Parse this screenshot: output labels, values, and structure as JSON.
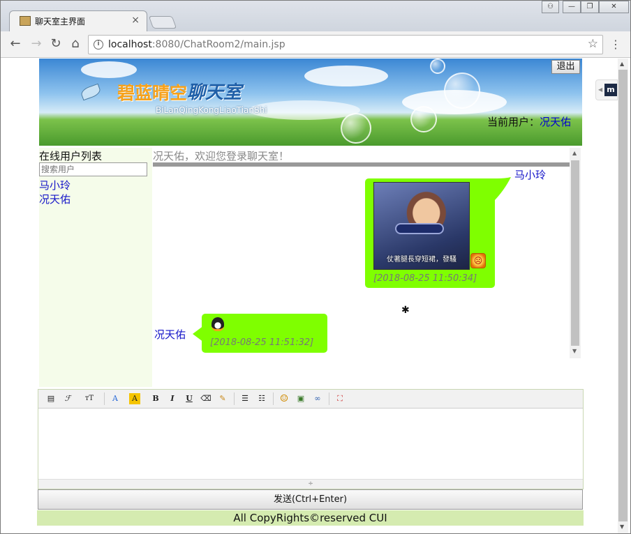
{
  "browser": {
    "tab_title": "聊天室主界面",
    "tab_close": "×",
    "url_host": "localhost",
    "url_rest": ":8080/ChatRoom2/main.jsp",
    "back_glyph": "←",
    "forward_glyph": "→",
    "reload_glyph": "↻",
    "home_glyph": "⌂",
    "star_glyph": "☆",
    "menu_glyph": "⋮",
    "info_glyph": "i",
    "window_buttons": [
      "⚇",
      "—",
      "❐",
      "✕"
    ]
  },
  "banner": {
    "logo_cn_part1": "碧蓝晴空",
    "logo_cn_part2": "聊天室",
    "logo_pinyin": "BiLanQingKongLiaoTianShi",
    "logout_label": "退出",
    "current_user_label": "当前用户：",
    "current_user_name": "况天佑"
  },
  "sidebar": {
    "heading": "在线用户列表",
    "search_placeholder": "搜索用户",
    "users": [
      "马小玲",
      "况天佑"
    ]
  },
  "chat": {
    "welcome": "况天佑，欢迎您登录聊天室！",
    "messages": [
      {
        "sender": "马小玲",
        "image_caption": "仗著腿長穿短裙，發騷",
        "timestamp": "[2018-08-25 11:50:34]"
      },
      {
        "sender": "况天佑",
        "timestamp": "[2018-08-25 11:51:32]"
      }
    ]
  },
  "editor": {
    "toolbar_icons": [
      "source-icon",
      "font-family-icon",
      "font-size-icon",
      "font-color-icon",
      "highlight-icon",
      "bold-icon",
      "italic-icon",
      "underline-icon",
      "eraser-icon",
      "clear-format-icon",
      "ordered-list-icon",
      "unordered-list-icon",
      "emoticon-icon",
      "insert-image-icon",
      "link-icon",
      "fullscreen-icon"
    ],
    "toolbar_glyphs": [
      "▤",
      "ℱ",
      "тT",
      "A",
      "A",
      "B",
      "I",
      "U",
      "⌫",
      "✎",
      "☰",
      "☷",
      "☺",
      "▣",
      "∞",
      "⛶"
    ],
    "resize_glyph": "÷",
    "send_label": "发送(Ctrl+Enter)"
  },
  "footer": {
    "text": "All CopyRights©reserved CUI"
  },
  "colors": {
    "bubble": "#7fff00",
    "link_blue": "#1515c8",
    "sidebar_bg": "#f5fcea",
    "footer_bg": "#d5ebb0"
  }
}
